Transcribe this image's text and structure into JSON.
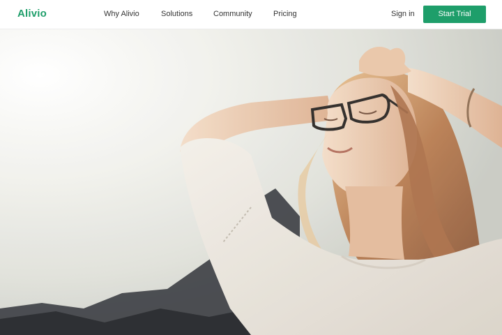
{
  "brand": {
    "name": "Alivio",
    "accent": "#1e9e6a"
  },
  "nav": {
    "links": [
      {
        "label": "Why Alivio"
      },
      {
        "label": "Solutions"
      },
      {
        "label": "Community"
      },
      {
        "label": "Pricing"
      }
    ],
    "sign_in": "Sign in",
    "cta": "Start Trial"
  },
  "hero": {
    "image_subject": "woman with glasses, eyes closed, hands on head, in warm sunlight"
  }
}
